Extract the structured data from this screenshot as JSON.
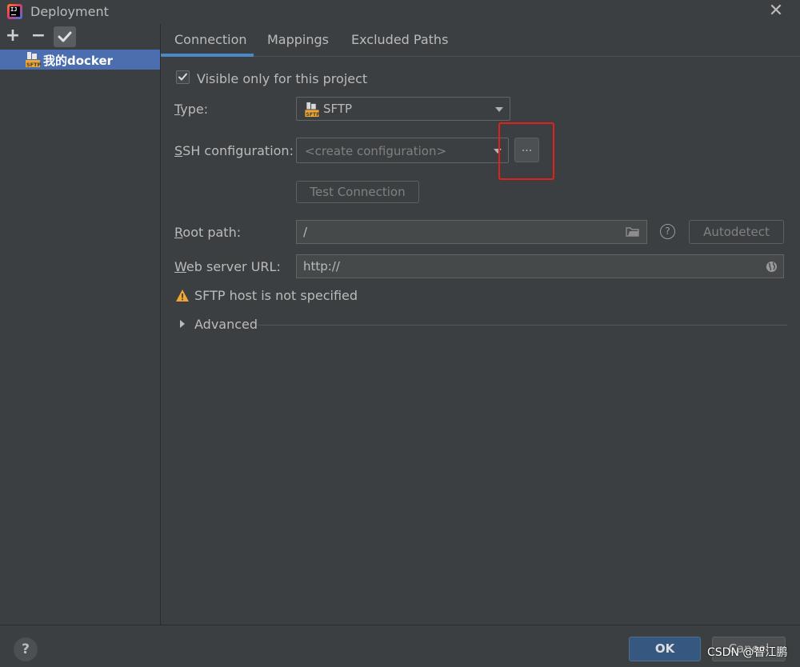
{
  "window": {
    "title": "Deployment",
    "close_symbol": "✕"
  },
  "sidebar": {
    "add_symbol": "+",
    "remove_symbol": "−",
    "servers": [
      {
        "label": "我的docker",
        "icon": "sftp-server-icon",
        "selected": true
      }
    ]
  },
  "tabs": [
    {
      "label": "Connection",
      "active": true
    },
    {
      "label": "Mappings",
      "active": false
    },
    {
      "label": "Excluded Paths",
      "active": false
    }
  ],
  "form": {
    "visible_only_label": "Visible only for this project",
    "visible_only_checked": true,
    "type_label_key": "T",
    "type_label_rest": "ype:",
    "type_value": "SFTP",
    "ssh_label_key": "S",
    "ssh_label_rest": "SH configuration:",
    "ssh_placeholder": "<create configuration>",
    "browse_label": "...",
    "test_connection_label": "Test Connection",
    "root_label_key": "R",
    "root_label_rest": "oot path:",
    "root_value": "/",
    "autodetect_label": "Autodetect",
    "web_label_key": "W",
    "web_label_rest": "eb server URL:",
    "web_value": "http://",
    "warning_text": "SFTP host is not specified",
    "advanced_label": "Advanced"
  },
  "footer": {
    "help_symbol": "?",
    "ok_label": "OK",
    "cancel_label": "Cancel",
    "watermark": "CSDN @智江鹏"
  },
  "colors": {
    "accent": "#4a88c7",
    "selection": "#4b6eaf",
    "highlight": "#e3211c",
    "warning": "#f0a732"
  }
}
